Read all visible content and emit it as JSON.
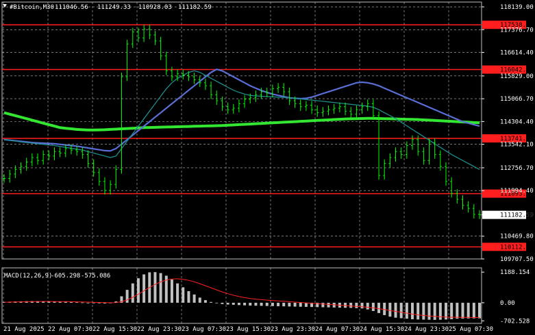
{
  "header": {
    "symbol": "#Bitcoin,M30",
    "open": "111046.56",
    "high": "111249.33",
    "low": "110928.03",
    "close": "111182.59",
    "current_price_label": "111182.59"
  },
  "macd": {
    "label": "MACD(12,26,9)",
    "main_value": "-605.298",
    "signal_value": "-575.086",
    "ticks": [
      "1188.154",
      "0.00",
      "-702.528"
    ],
    "tick_values": [
      1188.154,
      0,
      -702.528
    ]
  },
  "colors": {
    "background": "#000000",
    "grid": "#c0c0c0",
    "candle": "#00ff00",
    "ma_slow": "#32e632",
    "ma_mid": "#5a6fd6",
    "ma_fast": "#1e8c8c",
    "level_line": "#ff1e1e",
    "macd_hist": "#c0c0c0",
    "macd_signal": "#ff2020"
  },
  "chart_data": {
    "type": "line",
    "title": "#Bitcoin,M30",
    "ylim": [
      109707.5,
      118300
    ],
    "y_ticks": [
      {
        "value": 118139.0,
        "label": "118139.00"
      },
      {
        "value": 117376.7,
        "label": "117376.70"
      },
      {
        "value": 116614.4,
        "label": "116614.40"
      },
      {
        "value": 115829.0,
        "label": "115829.00"
      },
      {
        "value": 115066.7,
        "label": "115066.70"
      },
      {
        "value": 114304.4,
        "label": "114304.40"
      },
      {
        "value": 113542.1,
        "label": "113542.10"
      },
      {
        "value": 112756.7,
        "label": "112756.70"
      },
      {
        "value": 111994.4,
        "label": "111994.40"
      },
      {
        "value": 111182.59,
        "label": "111182.59"
      },
      {
        "value": 110469.8,
        "label": "110469.80"
      },
      {
        "value": 109707.5,
        "label": "109707.50"
      }
    ],
    "x_ticks": [
      "21 Aug 2025",
      "22 Aug 07:30",
      "22 Aug 15:30",
      "22 Aug 23:30",
      "23 Aug 07:30",
      "23 Aug 15:30",
      "23 Aug 23:30",
      "24 Aug 07:30",
      "24 Aug 15:30",
      "24 Aug 23:30",
      "25 Aug 07:30"
    ],
    "levels": [
      {
        "value": 117538.66,
        "label": "117538.66"
      },
      {
        "value": 116042.1,
        "label": "116042.10"
      },
      {
        "value": 113741.05,
        "label": "113741.05"
      },
      {
        "value": 111893.02,
        "label": "111893.02"
      },
      {
        "value": 110112.74,
        "label": "110112.74"
      }
    ],
    "series": [
      {
        "values": [
          112400,
          112550,
          112700,
          112800,
          112950,
          113100,
          113000,
          113200,
          113150,
          113300,
          113250,
          113400,
          113350,
          113300,
          113200,
          112900,
          112600,
          112300,
          112000,
          112200,
          112700,
          115800,
          116900,
          117300,
          117100,
          117400,
          117200,
          117000,
          116500,
          116000,
          115800,
          115900,
          115850,
          115800,
          115700,
          115600,
          115500,
          115200,
          115000,
          114800,
          114700,
          114750,
          114900,
          115050,
          115100,
          115200,
          115300,
          115250,
          115400,
          115450,
          115300,
          115000,
          114900,
          114800,
          114850,
          114700,
          114600,
          114650,
          114700,
          114750,
          114800,
          114650,
          114550,
          114700,
          114800,
          114900,
          114500,
          112500,
          112900,
          113100,
          113300,
          113200,
          113500,
          113700,
          113300,
          113000,
          113600,
          113200,
          112800,
          112300,
          111900,
          111700,
          111500,
          111400,
          111200,
          111182.59
        ]
      },
      {
        "values": [
          114600,
          114550,
          114500,
          114450,
          114400,
          114350,
          114300,
          114250,
          114200,
          114150,
          114100,
          114080,
          114060,
          114040,
          114030,
          114020,
          114020,
          114025,
          114030,
          114040,
          114050,
          114060,
          114070,
          114080,
          114090,
          114100,
          114105,
          114110,
          114115,
          114120,
          114125,
          114130,
          114135,
          114140,
          114145,
          114150,
          114155,
          114160,
          114165,
          114170,
          114180,
          114190,
          114200,
          114210,
          114220,
          114230,
          114240,
          114250,
          114260,
          114270,
          114280,
          114290,
          114300,
          114310,
          114320,
          114330,
          114340,
          114350,
          114360,
          114370,
          114380,
          114390,
          114395,
          114400,
          114405,
          114410,
          114410,
          114405,
          114400,
          114395,
          114390,
          114385,
          114380,
          114375,
          114370,
          114360,
          114350,
          114340,
          114330,
          114320,
          114310,
          114300,
          114290,
          114280,
          114270,
          114260
        ]
      },
      {
        "values": [
          113700,
          113680,
          113660,
          113640,
          113620,
          113600,
          113590,
          113580,
          113570,
          113560,
          113540,
          113520,
          113500,
          113480,
          113450,
          113420,
          113390,
          113360,
          113330,
          113320,
          113400,
          113550,
          113700,
          113850,
          114000,
          114150,
          114300,
          114450,
          114600,
          114750,
          114900,
          115050,
          115200,
          115350,
          115500,
          115650,
          115800,
          115950,
          116050,
          116000,
          115900,
          115800,
          115700,
          115600,
          115500,
          115420,
          115340,
          115280,
          115220,
          115180,
          115140,
          115100,
          115080,
          115070,
          115080,
          115120,
          115180,
          115240,
          115300,
          115360,
          115420,
          115480,
          115540,
          115600,
          115620,
          115600,
          115560,
          115500,
          115420,
          115340,
          115260,
          115180,
          115100,
          115020,
          114940,
          114860,
          114780,
          114700,
          114620,
          114540,
          114460,
          114380,
          114300,
          114250,
          114200,
          114150
        ]
      },
      {
        "values": [
          113700,
          113680,
          113650,
          113620,
          113600,
          113580,
          113560,
          113540,
          113520,
          113500,
          113470,
          113440,
          113410,
          113380,
          113350,
          113300,
          113250,
          113200,
          113150,
          113100,
          113150,
          113400,
          113650,
          113900,
          114150,
          114400,
          114650,
          114900,
          115150,
          115400,
          115600,
          115750,
          115850,
          115950,
          116000,
          115950,
          115850,
          115750,
          115650,
          115550,
          115450,
          115350,
          115280,
          115220,
          115180,
          115160,
          115150,
          115140,
          115130,
          115120,
          115110,
          115100,
          115080,
          115060,
          115040,
          115020,
          115000,
          114980,
          114960,
          114940,
          114920,
          114900,
          114880,
          114860,
          114840,
          114820,
          114780,
          114700,
          114600,
          114500,
          114400,
          114280,
          114160,
          114040,
          113920,
          113800,
          113680,
          113560,
          113440,
          113320,
          113200,
          113100,
          113000,
          112900,
          112800,
          112700
        ]
      }
    ],
    "macd_histogram": [
      30,
      40,
      50,
      55,
      60,
      62,
      64,
      60,
      55,
      50,
      45,
      40,
      30,
      20,
      10,
      0,
      -10,
      -20,
      -30,
      -20,
      50,
      250,
      500,
      750,
      950,
      1100,
      1180,
      1188,
      1150,
      1050,
      900,
      750,
      600,
      450,
      320,
      200,
      100,
      30,
      -20,
      -50,
      -70,
      -80,
      -90,
      -100,
      -110,
      -115,
      -120,
      -125,
      -130,
      -135,
      -140,
      -145,
      -150,
      -155,
      -160,
      -165,
      -170,
      -175,
      -180,
      -185,
      -190,
      -195,
      -200,
      -210,
      -220,
      -260,
      -320,
      -400,
      -480,
      -540,
      -580,
      -600,
      -620,
      -640,
      -650,
      -655,
      -660,
      -665,
      -660,
      -650,
      -640,
      -620,
      -615,
      -610,
      -606,
      -605.298
    ],
    "macd_signal": [
      20,
      25,
      30,
      35,
      40,
      45,
      48,
      50,
      50,
      48,
      46,
      43,
      40,
      35,
      30,
      24,
      18,
      12,
      6,
      0,
      5,
      40,
      110,
      210,
      330,
      460,
      590,
      710,
      810,
      880,
      920,
      930,
      910,
      870,
      810,
      740,
      660,
      580,
      500,
      420,
      350,
      290,
      240,
      200,
      165,
      140,
      120,
      100,
      85,
      70,
      55,
      40,
      25,
      10,
      -5,
      -20,
      -35,
      -50,
      -65,
      -80,
      -95,
      -110,
      -125,
      -140,
      -155,
      -175,
      -200,
      -230,
      -265,
      -300,
      -335,
      -370,
      -405,
      -440,
      -470,
      -495,
      -515,
      -530,
      -545,
      -555,
      -562,
      -567,
      -570,
      -572,
      -574,
      -575.086
    ]
  }
}
